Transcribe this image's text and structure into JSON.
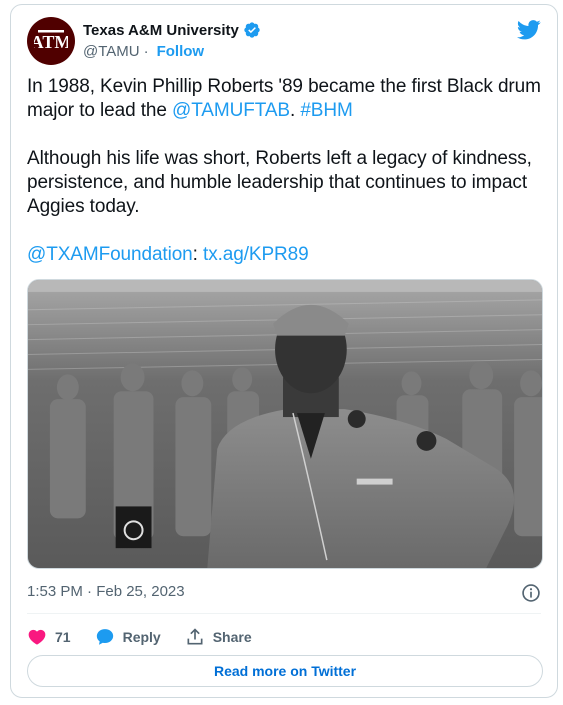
{
  "colors": {
    "accent": "#1d9bf0",
    "like": "#f91880",
    "maroon": "#500000",
    "muted": "#536471"
  },
  "author": {
    "avatar_text": "ATM",
    "display_name": "Texas A&M University",
    "handle": "@TAMU",
    "separator": "·",
    "follow_label": "Follow",
    "verified_icon": "verified-badge-icon"
  },
  "brand_icon": "twitter-bird-icon",
  "tweet": {
    "line1_text": "In 1988, Kevin Phillip Roberts '89 became the first Black drum major to lead the ",
    "mention1": "@TAMUFTAB",
    "line1_sep": ". ",
    "hashtag": "#BHM",
    "paragraph2": "Although his life was short, Roberts left a legacy of kindness, persistence, and humble leadership that continues to impact Aggies today.",
    "mention2": "@TXAMFoundation",
    "colon": ": ",
    "link": "tx.ag/KPR89"
  },
  "photo": {
    "alt": "Black-and-white photo of a uniformed drum major standing with hands on hips in a stadium"
  },
  "meta": {
    "timestamp": "1:53 PM · Feb 25, 2023",
    "info_icon": "info-icon"
  },
  "actions": {
    "like_count": "71",
    "reply_label": "Reply",
    "share_label": "Share"
  },
  "footer": {
    "read_more_label": "Read more on Twitter"
  }
}
